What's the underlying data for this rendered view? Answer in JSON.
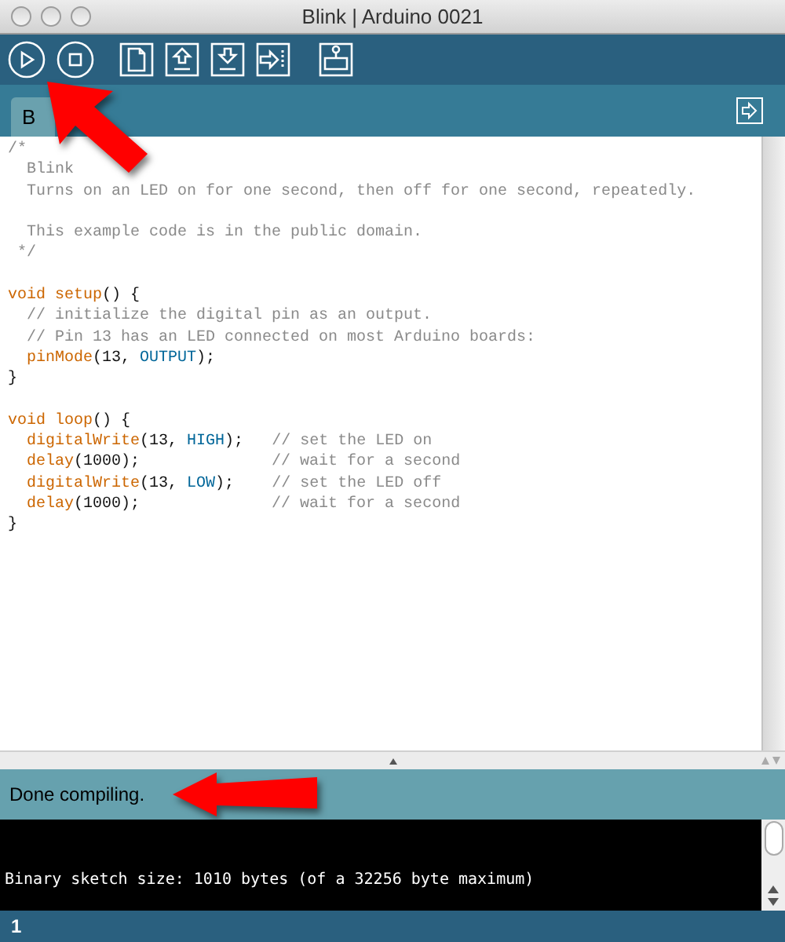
{
  "window": {
    "title": "Blink | Arduino 0021"
  },
  "tabs": [
    {
      "label": "B",
      "selected": true
    }
  ],
  "editor": {
    "lines": [
      {
        "kind": "code",
        "segments": [
          {
            "text": "/*",
            "kind": "comment"
          }
        ]
      },
      {
        "kind": "code",
        "segments": [
          {
            "text": "  Blink",
            "kind": "comment"
          }
        ]
      },
      {
        "kind": "code",
        "segments": [
          {
            "text": "  Turns on an LED on for one second, then off for one second, repeatedly.",
            "kind": "comment"
          }
        ]
      },
      {
        "kind": "blank"
      },
      {
        "kind": "code",
        "segments": [
          {
            "text": "  This example code is in the public domain.",
            "kind": "comment"
          }
        ]
      },
      {
        "kind": "code",
        "segments": [
          {
            "text": " */",
            "kind": "comment"
          }
        ]
      },
      {
        "kind": "blank"
      },
      {
        "kind": "code",
        "segments": [
          {
            "text": "void setup",
            "kind": "keyword"
          },
          {
            "text": "() {",
            "kind": "plain"
          }
        ]
      },
      {
        "kind": "code",
        "segments": [
          {
            "text": "  // initialize the digital pin as an output.",
            "kind": "comment"
          }
        ]
      },
      {
        "kind": "code",
        "segments": [
          {
            "text": "  // Pin 13 has an LED connected on most Arduino boards:",
            "kind": "comment"
          }
        ]
      },
      {
        "kind": "code",
        "segments": [
          {
            "text": "  pinMode",
            "kind": "keyword"
          },
          {
            "text": "(13, ",
            "kind": "plain"
          },
          {
            "text": "OUTPUT",
            "kind": "constant"
          },
          {
            "text": ");",
            "kind": "plain"
          }
        ]
      },
      {
        "kind": "code",
        "segments": [
          {
            "text": "}",
            "kind": "plain"
          }
        ]
      },
      {
        "kind": "blank"
      },
      {
        "kind": "code",
        "segments": [
          {
            "text": "void loop",
            "kind": "keyword"
          },
          {
            "text": "() {",
            "kind": "plain"
          }
        ]
      },
      {
        "kind": "code",
        "segments": [
          {
            "text": "  digitalWrite",
            "kind": "keyword"
          },
          {
            "text": "(13, ",
            "kind": "plain"
          },
          {
            "text": "HIGH",
            "kind": "constant"
          },
          {
            "text": ");   ",
            "kind": "plain"
          },
          {
            "text": "// set the LED on",
            "kind": "comment"
          }
        ]
      },
      {
        "kind": "code",
        "segments": [
          {
            "text": "  delay",
            "kind": "keyword"
          },
          {
            "text": "(1000);              ",
            "kind": "plain"
          },
          {
            "text": "// wait for a second",
            "kind": "comment"
          }
        ]
      },
      {
        "kind": "code",
        "segments": [
          {
            "text": "  digitalWrite",
            "kind": "keyword"
          },
          {
            "text": "(13, ",
            "kind": "plain"
          },
          {
            "text": "LOW",
            "kind": "constant"
          },
          {
            "text": ");    ",
            "kind": "plain"
          },
          {
            "text": "// set the LED off",
            "kind": "comment"
          }
        ]
      },
      {
        "kind": "code",
        "segments": [
          {
            "text": "  delay",
            "kind": "keyword"
          },
          {
            "text": "(1000);              ",
            "kind": "plain"
          },
          {
            "text": "// wait for a second",
            "kind": "comment"
          }
        ]
      },
      {
        "kind": "code",
        "segments": [
          {
            "text": "}",
            "kind": "plain"
          }
        ]
      }
    ]
  },
  "status": {
    "message": "Done compiling."
  },
  "console": {
    "lines": [
      "Binary sketch size: 1010 bytes (of a 32256 byte maximum)"
    ]
  },
  "footer": {
    "line_number": "1"
  }
}
